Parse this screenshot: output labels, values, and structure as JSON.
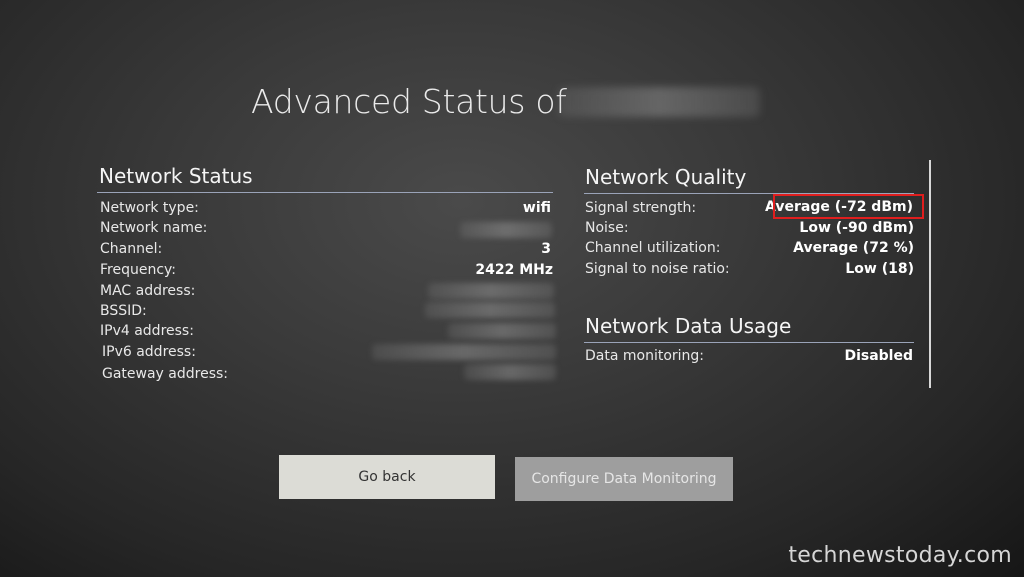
{
  "page_title": "Advanced Status of",
  "network_status": {
    "heading": "Network Status",
    "rows": [
      {
        "label": "Network type:",
        "value": "wifi"
      },
      {
        "label": "Network name:",
        "value": ""
      },
      {
        "label": "Channel:",
        "value": "3"
      },
      {
        "label": "Frequency:",
        "value": "2422 MHz"
      },
      {
        "label": "MAC address:",
        "value": ""
      },
      {
        "label": "BSSID:",
        "value": ""
      },
      {
        "label": "IPv4 address:",
        "value": ""
      },
      {
        "label": "IPv6 address:",
        "value": ""
      },
      {
        "label": "Gateway address:",
        "value": ""
      }
    ]
  },
  "network_quality": {
    "heading": "Network Quality",
    "rows": [
      {
        "label": "Signal strength:",
        "value": "Average (-72 dBm)"
      },
      {
        "label": "Noise:",
        "value": "Low (-90 dBm)"
      },
      {
        "label": "Channel utilization:",
        "value": "Average (72 %)"
      },
      {
        "label": "Signal to noise ratio:",
        "value": "Low (18)"
      }
    ]
  },
  "network_data_usage": {
    "heading": "Network Data Usage",
    "rows": [
      {
        "label": "Data monitoring:",
        "value": "Disabled"
      }
    ]
  },
  "buttons": {
    "go_back": "Go back",
    "configure": "Configure Data Monitoring"
  },
  "watermark": "technewstoday.com",
  "colors": {
    "highlight_box": "#e01e1e",
    "focused_button": "#dcdcd6",
    "unfocused_button": "#9e9e9e"
  }
}
